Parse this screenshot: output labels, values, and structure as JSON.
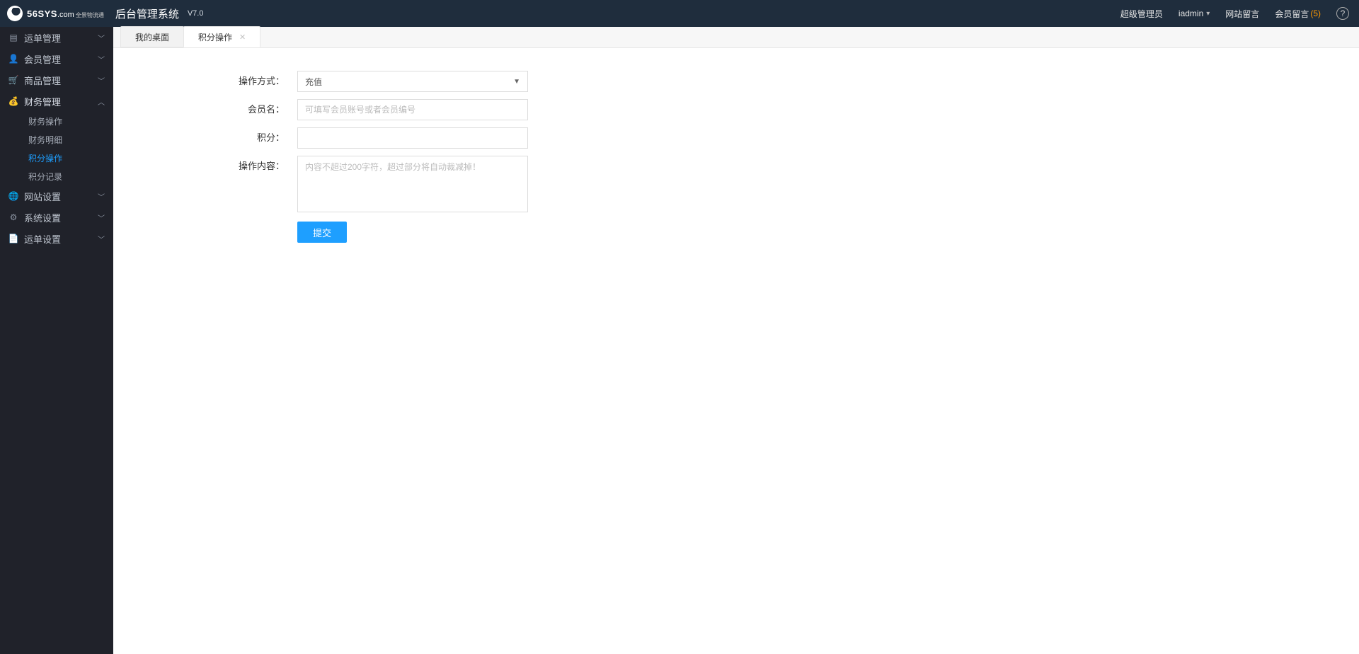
{
  "header": {
    "logo_text": "56SYS",
    "logo_ext": ".com",
    "logo_sub1": "全景物流通",
    "app_title": "后台管理系统",
    "version": "V7.0",
    "role": "超级管理员",
    "username": "iadmin",
    "site_msg": "网站留言",
    "member_msg": "会员留言",
    "member_msg_count": "(5)"
  },
  "sidebar": {
    "items": [
      {
        "icon": "order-icon",
        "label": "运单管理",
        "expanded": false
      },
      {
        "icon": "member-icon",
        "label": "会员管理",
        "expanded": false
      },
      {
        "icon": "product-icon",
        "label": "商品管理",
        "expanded": false
      },
      {
        "icon": "finance-icon",
        "label": "财务管理",
        "expanded": true,
        "children": [
          {
            "label": "财务操作",
            "active": false
          },
          {
            "label": "财务明细",
            "active": false
          },
          {
            "label": "积分操作",
            "active": true
          },
          {
            "label": "积分记录",
            "active": false
          }
        ]
      },
      {
        "icon": "site-icon",
        "label": "网站设置",
        "expanded": false
      },
      {
        "icon": "system-icon",
        "label": "系统设置",
        "expanded": false
      },
      {
        "icon": "waybill-icon",
        "label": "运单设置",
        "expanded": false
      }
    ]
  },
  "tabs": [
    {
      "label": "我的桌面",
      "active": false
    },
    {
      "label": "积分操作",
      "active": true,
      "closable": true
    }
  ],
  "form": {
    "operation_mode_label": "操作方式：",
    "operation_mode_value": "充值",
    "member_label": "会员名：",
    "member_placeholder": "可填写会员账号或者会员编号",
    "points_label": "积分：",
    "content_label": "操作内容：",
    "content_placeholder": "内容不超过200字符，超过部分将自动裁减掉！",
    "submit_label": "提交"
  }
}
